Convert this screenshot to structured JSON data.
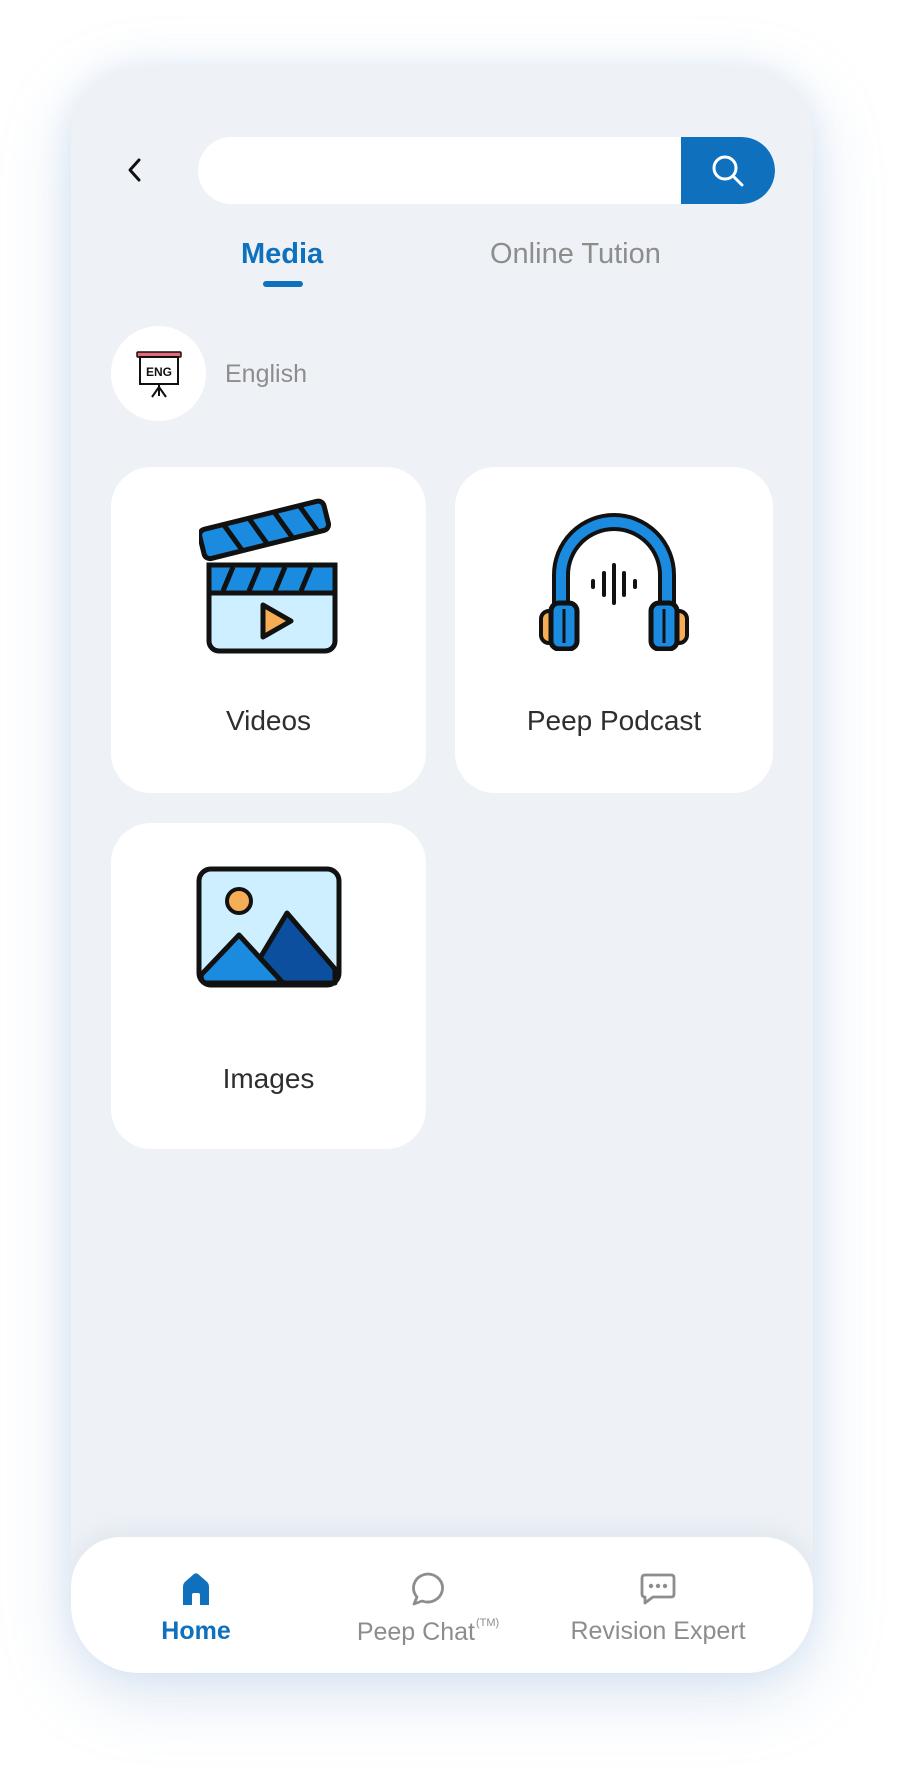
{
  "header": {
    "search_placeholder": "",
    "search_value": "",
    "back_icon": "chevron-left-icon",
    "search_icon": "search-icon"
  },
  "tabs": [
    {
      "label": "Media",
      "active": true
    },
    {
      "label": "Online Tution",
      "active": false
    }
  ],
  "subject": {
    "icon_text": "ENG",
    "label": "English"
  },
  "cards": [
    {
      "label": "Videos",
      "icon": "clapperboard-icon"
    },
    {
      "label": "Peep Podcast",
      "icon": "headphones-icon"
    },
    {
      "label": "Images",
      "icon": "image-icon"
    }
  ],
  "bottom_nav": {
    "items": [
      {
        "label": "Home",
        "icon": "home-icon",
        "active": true
      },
      {
        "label": "Peep Chat",
        "suffix": "(TM)",
        "icon": "chat-bubble-icon",
        "active": false
      },
      {
        "label": "Revision Expert",
        "icon": "message-dots-icon",
        "active": false
      }
    ]
  },
  "colors": {
    "accent": "#0f71bd",
    "background": "#eef2f6",
    "card": "#ffffff",
    "muted_text": "#8d8d8d"
  }
}
